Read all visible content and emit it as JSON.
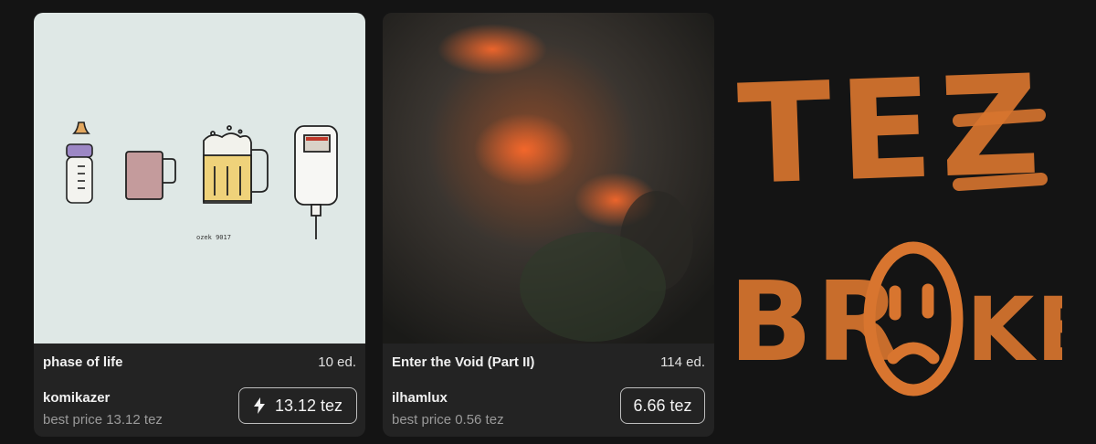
{
  "cards": [
    {
      "title": "phase of life",
      "editions": "10 ed.",
      "artist": "komikazer",
      "best_price": "best price 13.12 tez",
      "price_button": "13.12 tez",
      "price_icon": "lightning-icon",
      "signature": "ozek 9017"
    },
    {
      "title": "Enter the Void (Part II)",
      "editions": "114 ed.",
      "artist": "ilhamlux",
      "best_price": "best price 0.56 tez",
      "price_button": "6.66 tez"
    }
  ],
  "banner": {
    "line1": "TEZ",
    "line2": "BR",
    "line3": "KE",
    "color": "#d8752f"
  },
  "colors": {
    "background": "#141414",
    "card": "#232323",
    "art1_bg": "#dfe8e6"
  }
}
